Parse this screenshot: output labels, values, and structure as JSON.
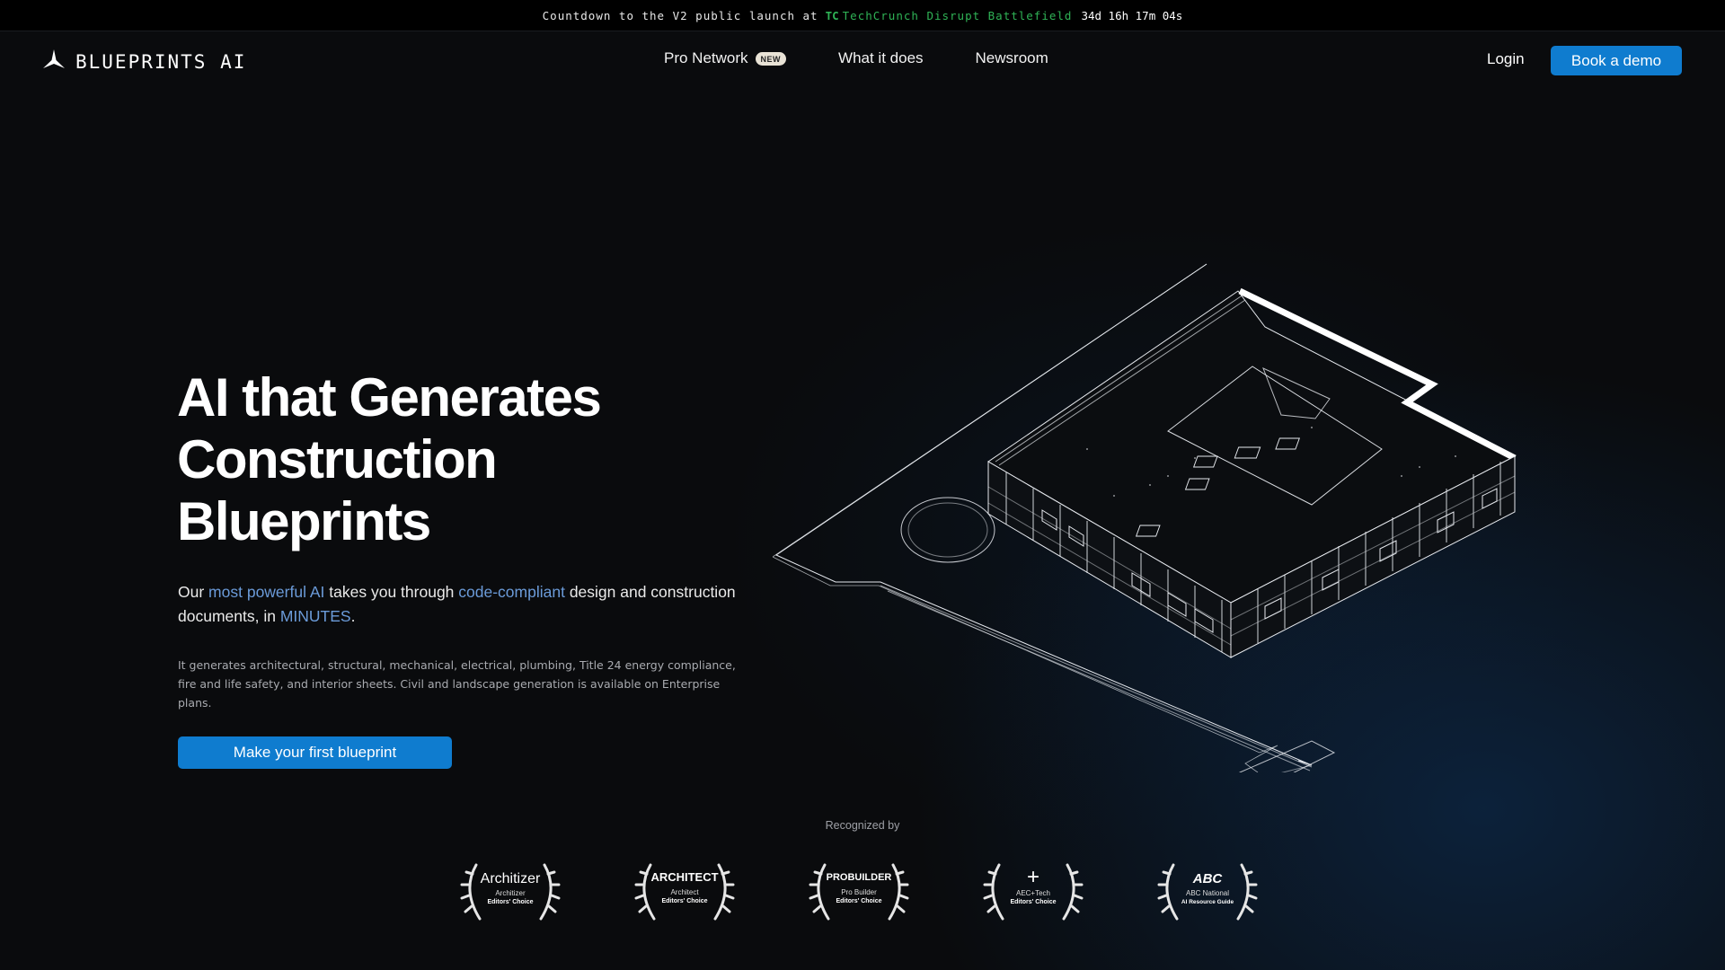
{
  "announcement": {
    "prefix": "Countdown to the V2 public launch at",
    "tc_logo": "TC",
    "event_name": "TechCrunch Disrupt Battlefield",
    "timer": "34d 16h 17m 04s"
  },
  "nav": {
    "brand": "BLUEPRINTS AI",
    "links": [
      {
        "label": "Pro Network",
        "badge": "NEW"
      },
      {
        "label": "What it does"
      },
      {
        "label": "Newsroom"
      }
    ],
    "login": "Login",
    "cta": "Book a demo"
  },
  "hero": {
    "title_lines": [
      "AI that Generates",
      "Construction",
      "Blueprints"
    ],
    "subtitle": {
      "p1": "Our ",
      "h1": "most powerful AI",
      "p2": " takes you through ",
      "h2": "code-compliant",
      "p3": " design and construction documents, in ",
      "h3": "MINUTES",
      "p4": "."
    },
    "description": "It generates architectural, structural, mechanical, electrical, plumbing, Title 24 energy compliance, fire and life safety, and interior sheets. Civil and landscape generation is available on Enterprise plans.",
    "cta": "Make your first blueprint"
  },
  "recognition": {
    "label": "Recognized by",
    "awards": [
      {
        "title": "Architizer",
        "sub1": "Architizer",
        "sub2": "Editors' Choice"
      },
      {
        "title": "ARCHITECT",
        "sub1": "Architect",
        "sub2": "Editors' Choice"
      },
      {
        "title": "PROBUILDER",
        "sub1": "Pro Builder",
        "sub2": "Editors' Choice"
      },
      {
        "title": "+",
        "sub1": "AEC+Tech",
        "sub2": "Editors' Choice"
      },
      {
        "title": "ABC",
        "sub1": "ABC National",
        "sub2": "AI Resource Guide"
      }
    ]
  },
  "colors": {
    "accent": "#0f7ccf",
    "highlight": "#6b9bd9",
    "tc_green": "#2fb356"
  },
  "icons": {
    "brand": "tri-blade-logo-icon",
    "award_frame": "laurel-wreath-icon"
  }
}
